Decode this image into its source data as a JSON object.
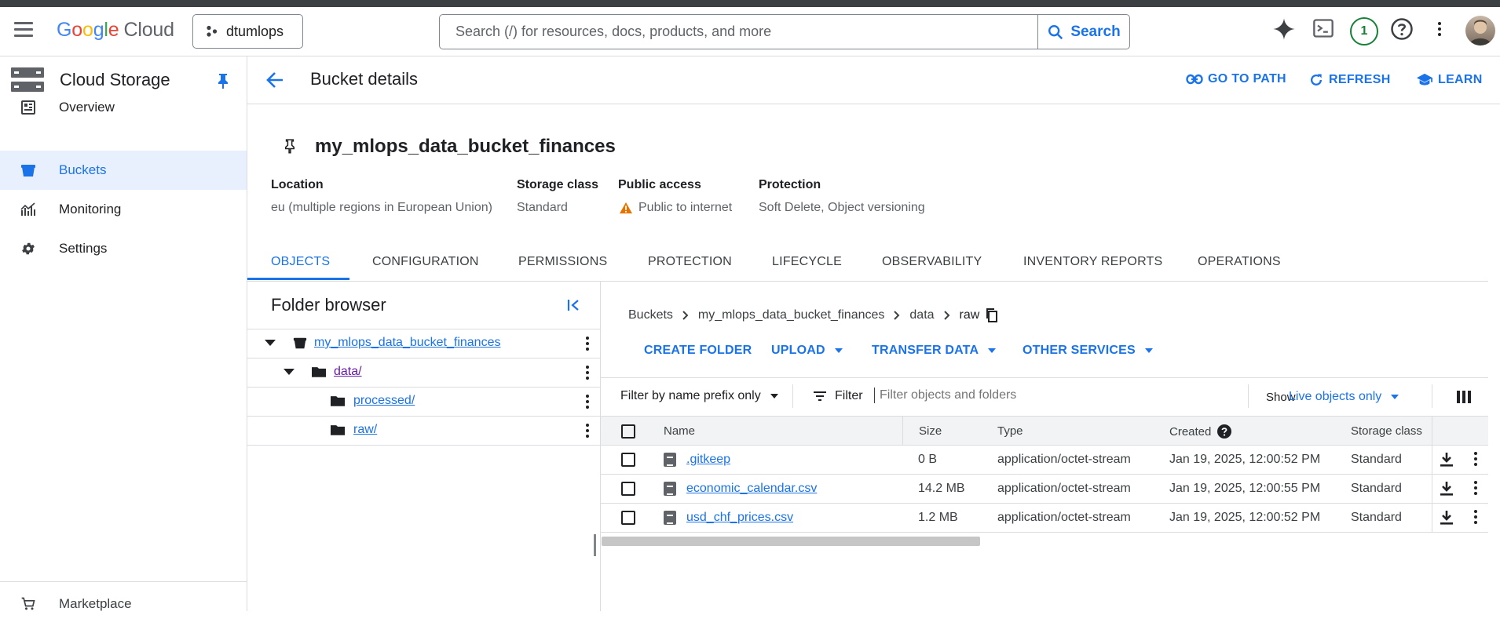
{
  "topbar": {
    "brand": {
      "g1": "G",
      "g2": "o",
      "g3": "o",
      "g4": "g",
      "g5": "l",
      "g6": "e",
      "cloud": "Cloud"
    },
    "project": "dtumlops",
    "search_placeholder": "Search (/) for resources, docs, products, and more",
    "search_button": "Search",
    "notifications_count": "1"
  },
  "sidebar": {
    "title": "Cloud Storage",
    "items": [
      {
        "label": "Overview",
        "icon": "overview-icon"
      },
      {
        "label": "Buckets",
        "icon": "bucket-icon",
        "active": true
      },
      {
        "label": "Monitoring",
        "icon": "monitoring-icon"
      },
      {
        "label": "Settings",
        "icon": "gear-icon"
      }
    ],
    "bottom_item": "Marketplace"
  },
  "header": {
    "title": "Bucket details",
    "actions": [
      "GO TO PATH",
      "REFRESH",
      "LEARN"
    ]
  },
  "bucket": {
    "name": "my_mlops_data_bucket_finances",
    "meta": [
      {
        "label": "Location",
        "value": "eu (multiple regions in European Union)"
      },
      {
        "label": "Storage class",
        "value": "Standard"
      },
      {
        "label": "Public access",
        "value": "Public to internet"
      },
      {
        "label": "Protection",
        "value": "Soft Delete, Object versioning"
      }
    ]
  },
  "tabs": [
    "OBJECTS",
    "CONFIGURATION",
    "PERMISSIONS",
    "PROTECTION",
    "LIFECYCLE",
    "OBSERVABILITY",
    "INVENTORY REPORTS",
    "OPERATIONS"
  ],
  "folder_browser": {
    "title": "Folder browser",
    "tree": [
      {
        "label": "my_mlops_data_bucket_finances",
        "level": 0
      },
      {
        "label": "data/",
        "level": 1
      },
      {
        "label": "processed/",
        "level": 2
      },
      {
        "label": "raw/",
        "level": 2
      }
    ]
  },
  "breadcrumb": [
    "Buckets",
    "my_mlops_data_bucket_finances",
    "data",
    "raw"
  ],
  "object_actions": [
    "CREATE FOLDER",
    "UPLOAD",
    "TRANSFER DATA",
    "OTHER SERVICES"
  ],
  "filter": {
    "mode": "Filter by name prefix only",
    "label": "Filter",
    "placeholder": "Filter objects and folders",
    "show_label": "Show",
    "show_value": "Live objects only"
  },
  "table": {
    "headers": [
      "Name",
      "Size",
      "Type",
      "Created",
      "Storage class"
    ],
    "rows": [
      {
        "name": ".gitkeep",
        "size": "0 B",
        "type": "application/octet-stream",
        "created": "Jan 19, 2025, 12:00:52 PM",
        "storage_class": "Standard"
      },
      {
        "name": "economic_calendar.csv",
        "size": "14.2 MB",
        "type": "application/octet-stream",
        "created": "Jan 19, 2025, 12:00:55 PM",
        "storage_class": "Standard"
      },
      {
        "name": "usd_chf_prices.csv",
        "size": "1.2 MB",
        "type": "application/octet-stream",
        "created": "Jan 19, 2025, 12:00:52 PM",
        "storage_class": "Standard"
      }
    ]
  },
  "colors": {
    "accent": "#1a73e8",
    "warning": "#e37400",
    "link_visited": "#681da8"
  }
}
